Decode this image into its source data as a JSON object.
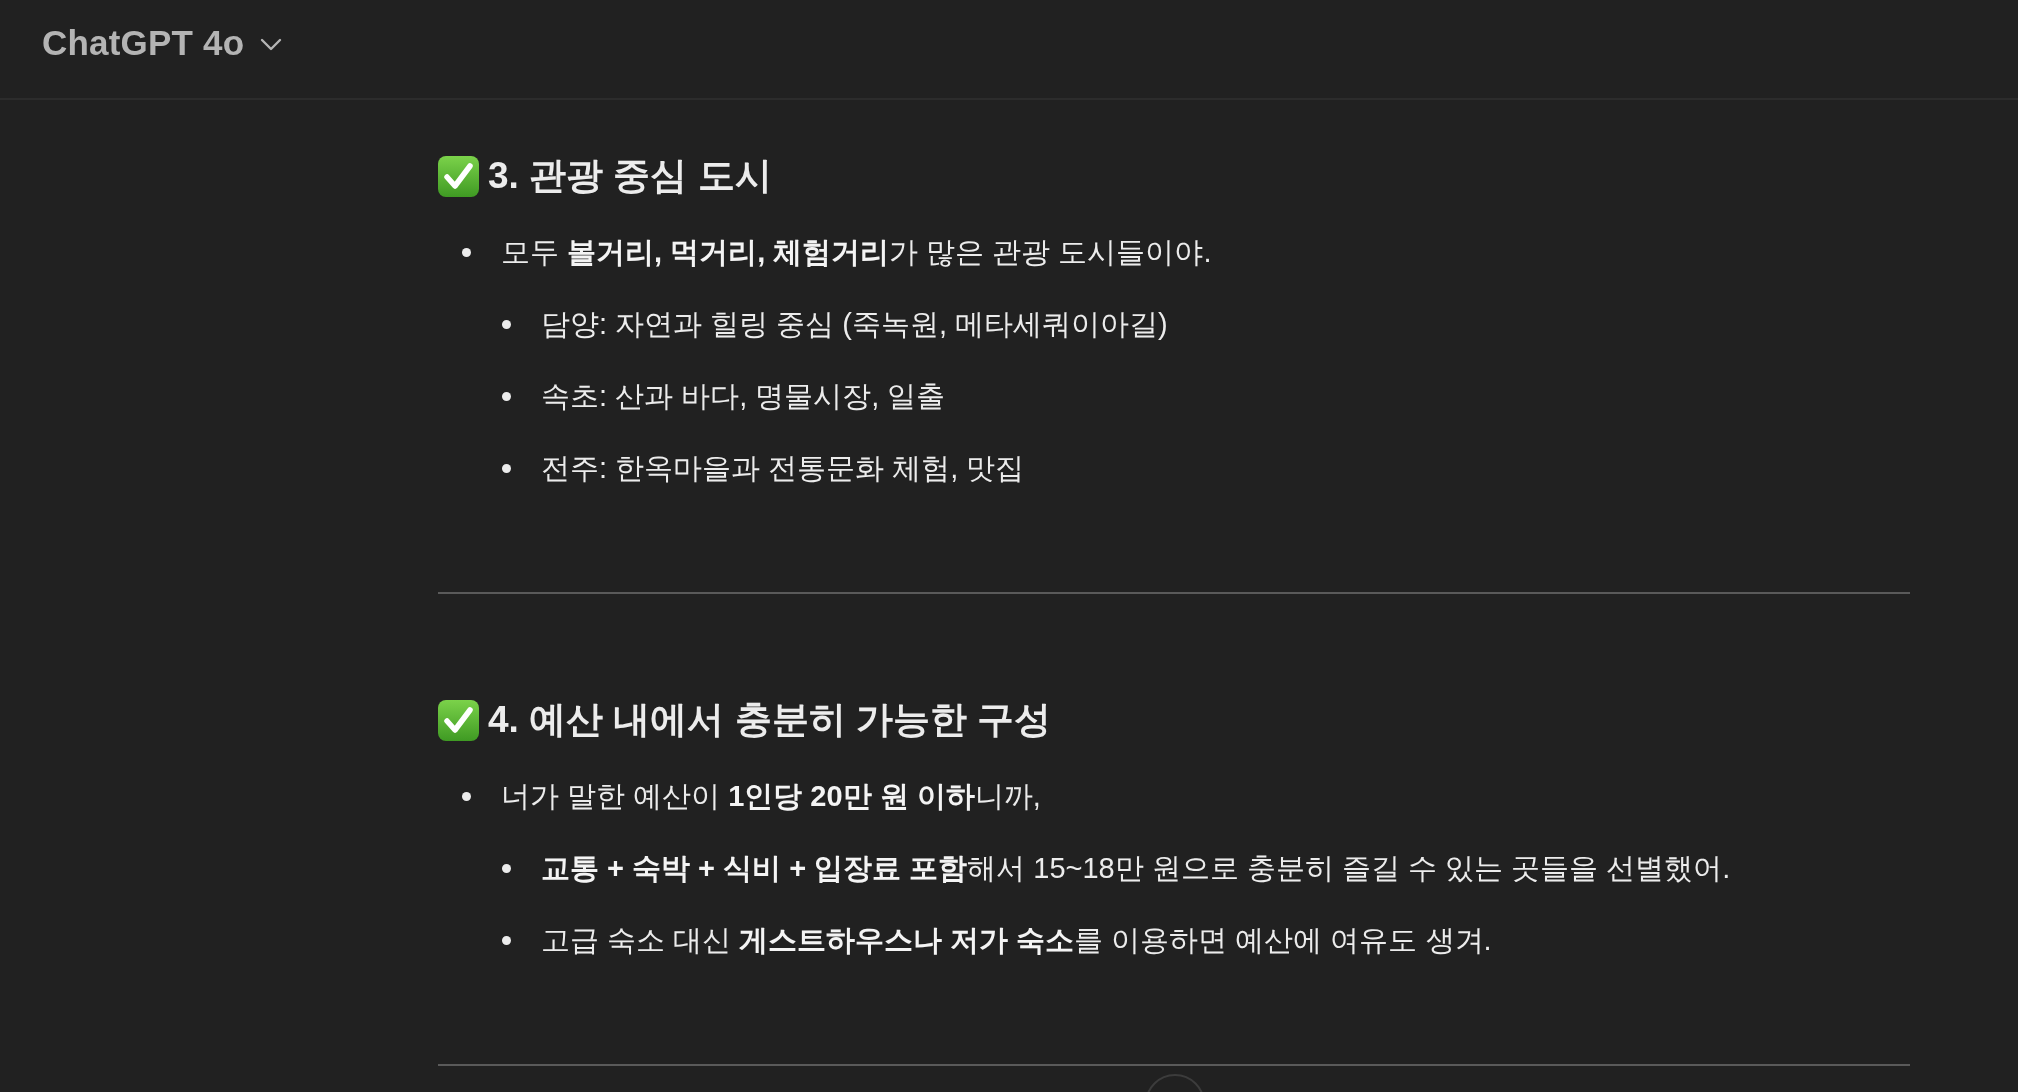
{
  "header": {
    "title": "ChatGPT 4o"
  },
  "sections": [
    {
      "heading": "3. 관광 중심 도시",
      "bullets": [
        {
          "text": "모두 **볼거리, 먹거리, 체험거리**가 많은 관광 도시들이야.",
          "children": [
            {
              "text": "담양: 자연과 힐링 중심 (죽녹원, 메타세쿼이아길)"
            },
            {
              "text": "속초: 산과 바다, 명물시장, 일출"
            },
            {
              "text": "전주: 한옥마을과 전통문화 체험, 맛집"
            }
          ]
        }
      ]
    },
    {
      "heading": "4. 예산 내에서 충분히 가능한 구성",
      "bullets": [
        {
          "text": "너가 말한 예산이 **1인당 20만 원 이하**니까,",
          "children": [
            {
              "text": "**교통 + 숙박 + 식비 + 입장료 포함**해서 15~18만 원으로 충분히 즐길 수 있는 곳들을 선별했어."
            },
            {
              "text": "고급 숙소 대신 **게스트하우스나 저가 숙소**를 이용하면 예산에 여유도 생겨."
            }
          ]
        }
      ]
    }
  ]
}
